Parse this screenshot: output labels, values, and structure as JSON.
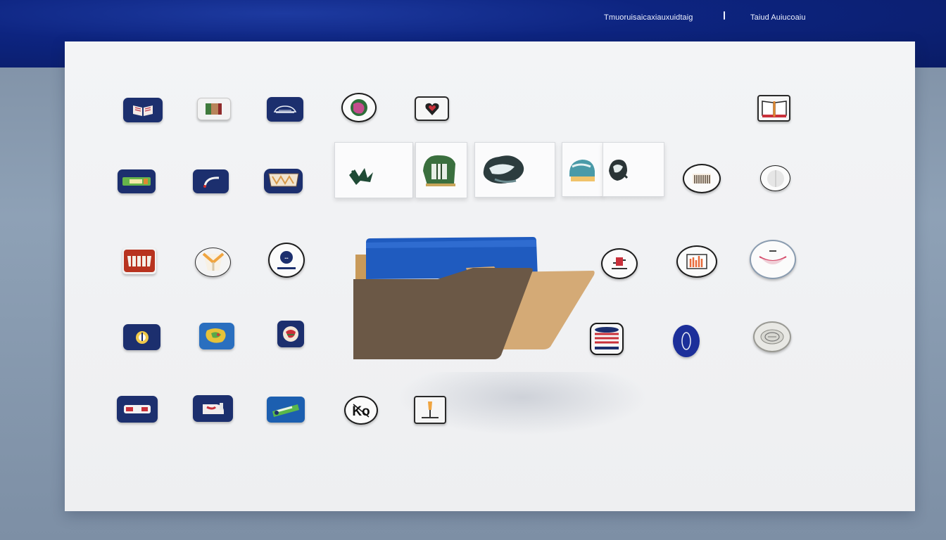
{
  "topbar": {
    "title_left": "Tmuoruisaicaxiauxuidtaig",
    "title_right": "Taiud Auiucoaiu"
  },
  "icons": {
    "row1": [
      "book-icon",
      "battery-icon",
      "vehicle-icon",
      "globe-icon",
      "heart-icon",
      "open-book-icon"
    ],
    "row2": [
      "ticket-icon",
      "phone-icon",
      "bridge-icon",
      "piano-icon",
      "disc-icon"
    ],
    "row3": [
      "dentures-icon",
      "scarf-icon",
      "badge-icon",
      "stamp-icon",
      "bar-chart-icon",
      "bowl-icon"
    ],
    "row4": [
      "camera-icon",
      "map-icon",
      "gift-icon",
      "drum-icon",
      "ring-icon",
      "coin-icon"
    ],
    "row5": [
      "bus-icon",
      "boot-icon",
      "pencil-case-icon",
      "logo-icon",
      "torch-icon"
    ],
    "preview_cards": [
      "leaf-art-icon",
      "forest-art-icon",
      "cloud-art-icon",
      "wave-art-icon",
      "stone-art-icon"
    ],
    "folder": "folder-icon"
  },
  "colors": {
    "topbar": "#0d2480",
    "canvas": "#f1f2f4",
    "app_tile": "#1c2f6e",
    "folder_front": "#6b5846",
    "folder_back": "#d4aa76",
    "folder_doc": "#1f5bbf"
  }
}
